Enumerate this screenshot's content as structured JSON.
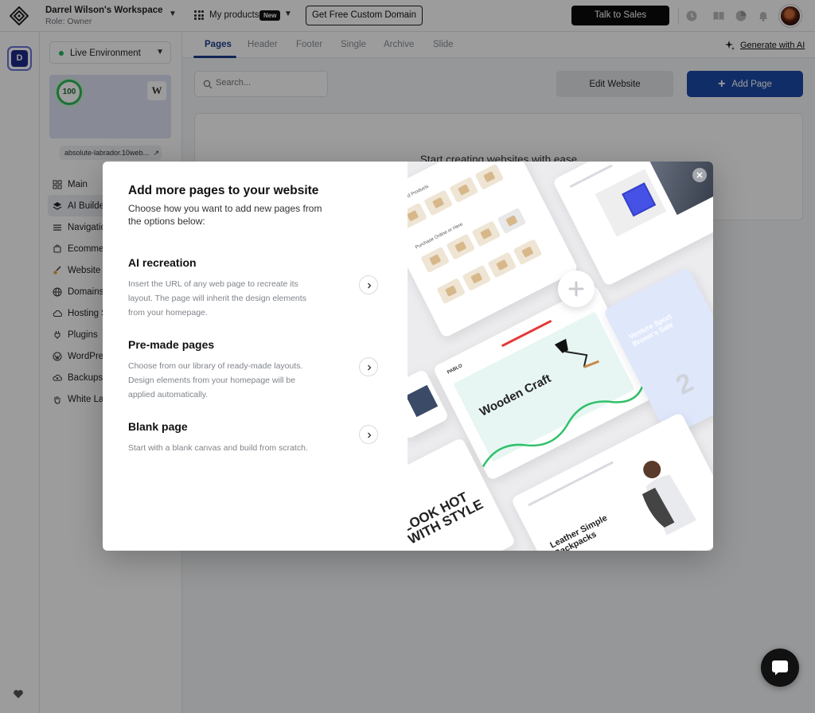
{
  "topbar": {
    "workspace_name": "Darrel Wilson's Workspace",
    "workspace_role": "Role: Owner",
    "my_products": "My products",
    "new_badge": "New",
    "free_domain": "Get Free Custom Domain",
    "talk_to_sales": "Talk to Sales"
  },
  "rail": {
    "workspace_initial": "D"
  },
  "sidebar": {
    "environment": "Live Environment",
    "score": "100",
    "site_url": "absolute-labrador.10web...",
    "items": [
      {
        "label": "Main",
        "icon": "grid-icon"
      },
      {
        "label": "AI Builder",
        "icon": "layers-icon"
      },
      {
        "label": "Navigation",
        "icon": "menu-icon"
      },
      {
        "label": "Ecommerce",
        "icon": "cart-icon"
      },
      {
        "label": "Website Editor",
        "icon": "brush-icon"
      },
      {
        "label": "Domains",
        "icon": "globe-icon"
      },
      {
        "label": "Hosting Services",
        "icon": "cloud-icon"
      },
      {
        "label": "Plugins",
        "icon": "plug-icon"
      },
      {
        "label": "WordPress",
        "icon": "wordpress-icon"
      },
      {
        "label": "Backups",
        "icon": "backup-icon"
      },
      {
        "label": "White Label",
        "icon": "hand-icon"
      }
    ]
  },
  "main": {
    "tabs": [
      "Pages",
      "Header",
      "Footer",
      "Single",
      "Archive",
      "Slide"
    ],
    "generate_ai": "Generate with AI",
    "search_placeholder": "Search...",
    "edit_website": "Edit Website",
    "add_page": "Add Page",
    "empty_text": "Start creating websites with ease"
  },
  "modal": {
    "title": "Add more pages to your website",
    "subtitle": "Choose how you want to add new pages from the options below:",
    "options": [
      {
        "title": "AI recreation",
        "desc": "Insert the URL of any web page to recreate its layout. The page will inherit the design elements from your homepage."
      },
      {
        "title": "Pre-made pages",
        "desc": "Choose from our library of ready-made layouts. Design elements from your homepage will be applied automatically."
      },
      {
        "title": "Blank page",
        "desc": "Start with a blank canvas and build from scratch."
      }
    ],
    "art": {
      "featured_products": "Featured Products",
      "purchase_online": "Purchase Online or Here",
      "wooden_craft": "Wooden Craft",
      "pablo": "PABLO",
      "look_hot": "LOOK HOT WITH STYLE",
      "leather": "Leather Simple Backpacks",
      "venture": "Venture Sport Brown's Sale"
    }
  },
  "colors": {
    "accent": "#1d4ba9",
    "tab_active": "#1c3f8f",
    "live_dot": "#24b561",
    "score_ring": "#2eb85c"
  }
}
